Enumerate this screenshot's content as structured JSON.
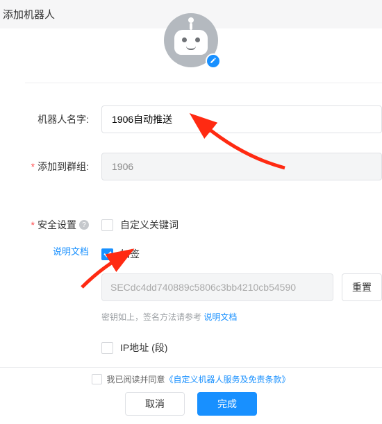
{
  "header": {
    "title": "添加机器人"
  },
  "avatar": {
    "edit_icon": "pencil-icon"
  },
  "form": {
    "name_label": "机器人名字:",
    "name_value": "1906自动推送",
    "group_label": "添加到群组:",
    "group_value": "1906"
  },
  "security": {
    "title": "安全设置",
    "doc_link": "说明文档",
    "keyword_label": "自定义关键词",
    "sign_label": "加签",
    "secret_value": "SECdc4dd740889c5806c3bb4210cb54590",
    "reset_label": "重置",
    "hint_prefix": "密钥如上，签名方法请参考 ",
    "hint_link": "说明文档",
    "ip_label": "IP地址 (段)"
  },
  "footer": {
    "agree_text": "我已阅读并同意",
    "agree_link": "《自定义机器人服务及免责条款》",
    "cancel": "取消",
    "confirm": "完成"
  }
}
